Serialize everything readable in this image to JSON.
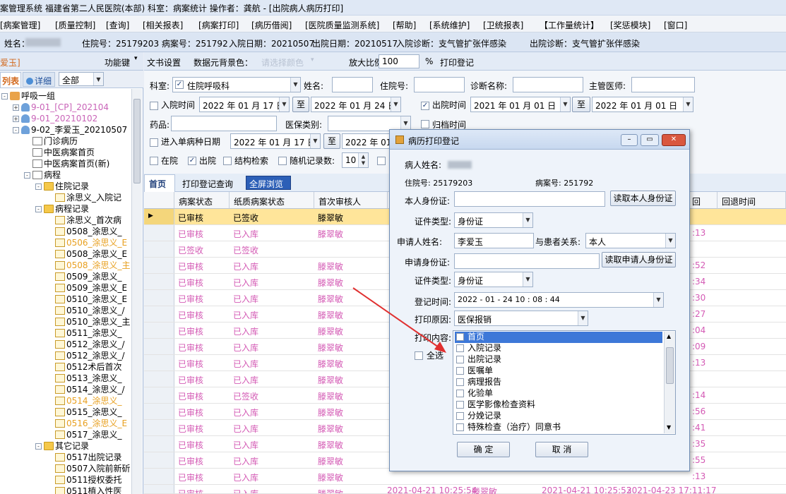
{
  "title": {
    "text": "案管理系统  福建省第二人民医院(本部)  科室：病案统计  操作者：龚航 - [出院病人病历打印]"
  },
  "menu": [
    "[病案管理]",
    "[质量控制]",
    "[查询]",
    "[相关报表]",
    "[病案打印]",
    "[病历借阅]",
    "[医院质量监测系统]",
    "[帮助]",
    "[系统维护]",
    "[卫统报表]",
    "【工作量统计】",
    "[奖惩模块]",
    "[窗口]"
  ],
  "info": {
    "name_label": "姓名：",
    "inpatient_no": "住院号：25179203 病案号：251792",
    "admit_date": "入院日期：20210507",
    "discharge_date": "出院日期：20210517",
    "admit_diag": "入院诊断：支气管扩张伴感染",
    "discharge_diag": "出院诊断：支气管扩张伴感染"
  },
  "left": {
    "header_name": "爱玉]",
    "func_key": "功能键",
    "tabs": [
      "列表",
      "详细"
    ],
    "filter_value": "全部",
    "tree": [
      {
        "label": "呼吸一组",
        "level": 0,
        "icon": "group",
        "exp": "-",
        "color": "#000"
      },
      {
        "label": "9-01_[CP]_202104",
        "level": 1,
        "icon": "person",
        "exp": "+",
        "color": "#c964b8"
      },
      {
        "label": "9-01_20210102",
        "level": 1,
        "icon": "person",
        "exp": "+",
        "color": "#c964b8"
      },
      {
        "label": "9-02_李爱玉_20210507",
        "level": 1,
        "icon": "person",
        "exp": "-",
        "color": "#000"
      },
      {
        "label": "门诊病历",
        "level": 2,
        "icon": "doc",
        "exp": "",
        "color": "#000"
      },
      {
        "label": "中医病案首页",
        "level": 2,
        "icon": "doc",
        "exp": "",
        "color": "#000"
      },
      {
        "label": "中医病案首页(新)",
        "level": 2,
        "icon": "doc",
        "exp": "",
        "color": "#000"
      },
      {
        "label": "病程",
        "level": 2,
        "icon": "doc",
        "exp": "-",
        "color": "#000"
      },
      {
        "label": "住院记录",
        "level": 3,
        "icon": "folder",
        "exp": "-",
        "color": "#000"
      },
      {
        "label": "涂思义_入院记",
        "level": 4,
        "icon": "lockdoc",
        "exp": "",
        "color": "#000"
      },
      {
        "label": "病程记录",
        "level": 3,
        "icon": "folder",
        "exp": "-",
        "color": "#000"
      },
      {
        "label": "涂思义_首次病",
        "level": 4,
        "icon": "lockdoc",
        "exp": "",
        "color": "#000"
      },
      {
        "label": "0508_涂思义_",
        "level": 4,
        "icon": "lockdoc",
        "exp": "",
        "color": "#000"
      },
      {
        "label": "0506_涂思义_E",
        "level": 4,
        "icon": "lockdoc",
        "exp": "",
        "color": "#e8a020"
      },
      {
        "label": "0508_涂思义_E",
        "level": 4,
        "icon": "lockdoc",
        "exp": "",
        "color": "#000"
      },
      {
        "label": "0508_涂思义_主",
        "level": 4,
        "icon": "lockdoc",
        "exp": "",
        "color": "#e8a020"
      },
      {
        "label": "0509_涂思义_",
        "level": 4,
        "icon": "lockdoc",
        "exp": "",
        "color": "#000"
      },
      {
        "label": "0509_涂思义_E",
        "level": 4,
        "icon": "lockdoc",
        "exp": "",
        "color": "#000"
      },
      {
        "label": "0510_涂思义_E",
        "level": 4,
        "icon": "lockdoc",
        "exp": "",
        "color": "#000"
      },
      {
        "label": "0510_涂思义_/",
        "level": 4,
        "icon": "lockdoc",
        "exp": "",
        "color": "#000"
      },
      {
        "label": "0510_涂思义_主",
        "level": 4,
        "icon": "lockdoc",
        "exp": "",
        "color": "#000"
      },
      {
        "label": "0511_涂思义_",
        "level": 4,
        "icon": "lockdoc",
        "exp": "",
        "color": "#000"
      },
      {
        "label": "0512_涂思义_/",
        "level": 4,
        "icon": "lockdoc",
        "exp": "",
        "color": "#000"
      },
      {
        "label": "0512_涂思义_/",
        "level": 4,
        "icon": "lockdoc",
        "exp": "",
        "color": "#000"
      },
      {
        "label": "0512术后首次",
        "level": 4,
        "icon": "lockdoc",
        "exp": "",
        "color": "#000"
      },
      {
        "label": "0513_涂思义_",
        "level": 4,
        "icon": "lockdoc",
        "exp": "",
        "color": "#000"
      },
      {
        "label": "0514_涂思义_/",
        "level": 4,
        "icon": "lockdoc",
        "exp": "",
        "color": "#000"
      },
      {
        "label": "0514_涂思义_",
        "level": 4,
        "icon": "lockdoc",
        "exp": "",
        "color": "#e8a020"
      },
      {
        "label": "0515_涂思义_",
        "level": 4,
        "icon": "lockdoc",
        "exp": "",
        "color": "#000"
      },
      {
        "label": "0516_涂思义_E",
        "level": 4,
        "icon": "lockdoc",
        "exp": "",
        "color": "#e8a020"
      },
      {
        "label": "0517_涂思义_",
        "level": 4,
        "icon": "lockdoc",
        "exp": "",
        "color": "#000"
      },
      {
        "label": "其它记录",
        "level": 3,
        "icon": "folder",
        "exp": "-",
        "color": "#000"
      },
      {
        "label": "0517出院记录",
        "level": 4,
        "icon": "lockdoc",
        "exp": "",
        "color": "#000"
      },
      {
        "label": "0507入院前新斫",
        "level": 4,
        "icon": "lockdoc",
        "exp": "",
        "color": "#000"
      },
      {
        "label": "0511授权委托",
        "level": 4,
        "icon": "lockdoc",
        "exp": "",
        "color": "#000"
      },
      {
        "label": "0511植入性医",
        "level": 4,
        "icon": "lockdoc",
        "exp": "",
        "color": "#000"
      }
    ]
  },
  "toolbar": {
    "doc_settings": "文书设置",
    "bg_color_label": "数据元背景色：",
    "bg_color_placeholder": "请选择颜色",
    "zoom_label": "放大比例：",
    "zoom_value": "100",
    "zoom_unit": "%",
    "print_reg": "打印登记"
  },
  "filters": {
    "dept_label": "科室:",
    "dept_value": "住院呼吸科",
    "name_label": "姓名:",
    "inpatient_label": "住院号:",
    "diag_label": "诊断名称:",
    "doctor_label": "主管医师:",
    "admit_time_label": "入院时间",
    "admit_from": "2022 年 01 月 17 日",
    "to_label": "至",
    "admit_to": "2022 年 01 月 24 日",
    "discharge_time_label": "出院时间",
    "discharge_from": "2021 年 01 月 01 日",
    "discharge_to": "2022 年 01 月 01 日",
    "drug_label": "药品:",
    "insurance_label": "医保类别:",
    "archive_label": "归档时间",
    "single_disease_label": "进入单病种日期",
    "sd_from": "2022 年 01 月 17 日",
    "sd_to": "2022 年 01",
    "in_hospital": "在院",
    "discharged": "出院",
    "struct_search": "结构检索",
    "random_count_label": "随机记录数:",
    "random_count": "10"
  },
  "tabs": {
    "home": "首页",
    "print_query": "打印登记查询",
    "fullscreen": "全屏浏览"
  },
  "grid": {
    "columns": [
      "病案状态",
      "纸质病案状态",
      "首次审核人"
    ],
    "right_columns": [
      "回",
      "回退时间"
    ],
    "first_row": [
      "已审核",
      "已签收",
      "滕翠敏"
    ],
    "rows": [
      [
        "已审核",
        "已入库",
        "滕翠敏"
      ],
      [
        "已签收",
        "已签收",
        ""
      ],
      [
        "已审核",
        "已入库",
        "滕翠敏"
      ],
      [
        "已审核",
        "已入库",
        "滕翠敏"
      ],
      [
        "已审核",
        "已入库",
        "滕翠敏"
      ],
      [
        "已审核",
        "已入库",
        "滕翠敏"
      ],
      [
        "已审核",
        "已入库",
        "滕翠敏"
      ],
      [
        "已审核",
        "已入库",
        "滕翠敏"
      ],
      [
        "已审核",
        "已入库",
        "滕翠敏"
      ],
      [
        "已审核",
        "已入库",
        "滕翠敏"
      ],
      [
        "已审核",
        "已签收",
        "滕翠敏"
      ],
      [
        "已审核",
        "已入库",
        "滕翠敏"
      ],
      [
        "已审核",
        "已入库",
        "滕翠敏"
      ],
      [
        "已审核",
        "已入库",
        "滕翠敏"
      ],
      [
        "已审核",
        "已入库",
        "滕翠敏"
      ],
      [
        "已审核",
        "已入库",
        "滕翠敏"
      ],
      [
        "已审核",
        "已入库",
        "滕翠敏"
      ],
      [
        "已审核",
        "已入库",
        "滕翠敏"
      ]
    ],
    "right_times": [
      ":13",
      "",
      ":52",
      ":34",
      ":30",
      ":27",
      ":04",
      ":09",
      ":13",
      "",
      ":14",
      ":56",
      ":41",
      ":35",
      ":55",
      ":13"
    ],
    "bottom_row": [
      "2021-04-21 10:25:54",
      "滕翠敏",
      "2021-04-21 10:25:53",
      "2021-04-23 17:11:17"
    ]
  },
  "dialog": {
    "title": "病历打印登记",
    "patient_name_label": "病人姓名:",
    "inpatient_no": "住院号: 25179203",
    "case_no": "病案号: 251792",
    "id_label": "本人身份证:",
    "read_id_btn": "读取本人身份证",
    "cert_type_label": "证件类型:",
    "cert_type_value": "身份证",
    "applicant_label": "申请人姓名:",
    "applicant_value": "李爱玉",
    "relation_label": "与患者关系:",
    "relation_value": "本人",
    "applicant_id_label": "申请身份证:",
    "read_applicant_btn": "读取申请人身份证",
    "cert_type2_value": "身份证",
    "reg_time_label": "登记时间:",
    "reg_time_value": "2022 - 01 - 24   10 : 08 : 44",
    "reason_label": "打印原因:",
    "reason_value": "医保报销",
    "content_label": "打印内容:",
    "select_all": "全选",
    "items": [
      "首页",
      "入院记录",
      "出院记录",
      "医嘱单",
      "病理报告",
      "化验单",
      "医学影像检查资料",
      "分娩记录",
      "特殊检查（治疗）同意书"
    ],
    "ok": "确  定",
    "cancel": "取  消"
  },
  "colors": {
    "pink": "#d45bb5",
    "selection": "#ffe59a",
    "dialog_highlight": "#3d78d8",
    "arrow": "#e03030"
  }
}
